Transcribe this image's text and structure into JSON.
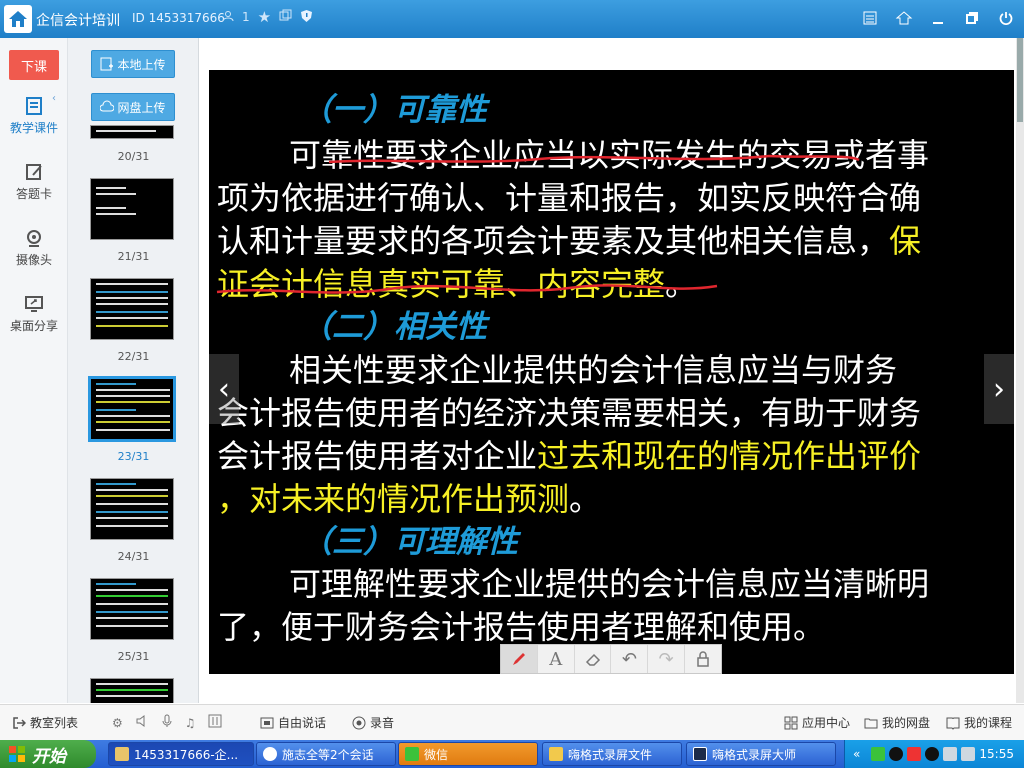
{
  "titlebar": {
    "app_name": "企信会计培训",
    "room_id": "ID 1453317666",
    "user_count": "1"
  },
  "sidebar": {
    "end_class": "下课",
    "items": [
      {
        "label": "教学课件"
      },
      {
        "label": "答题卡"
      },
      {
        "label": "摄像头"
      },
      {
        "label": "桌面分享"
      }
    ]
  },
  "panel": {
    "local_upload": "本地上传",
    "cloud_upload": "网盘上传",
    "pages": [
      "20/31",
      "21/31",
      "22/31",
      "23/31",
      "24/31",
      "25/31"
    ],
    "selected_page": "23/31"
  },
  "slide": {
    "h1": "（一）可靠性",
    "p1_lines": [
      "可靠性要求企业应当以实际发生的交易或者事",
      "项为依据进行确认、计量和报告，如实反映符合确",
      "认和计量要求的各项会计要素及其他相关信息，"
    ],
    "p1_highlight_a": "保",
    "p1_highlight_b": "证会计信息真实可靠、内容完整",
    "p1_end": "。",
    "h2": "（二）相关性",
    "p2_lines": [
      "相关性要求企业提供的会计信息应当与财务",
      "会计报告使用者的经济决策需要相关，有助于财务",
      "会计报告使用者对企业"
    ],
    "p2_highlight_a": "过去和现在的情况作出评价",
    "p2_highlight_b": "，对未来的情况作出预测",
    "p2_end": "。",
    "h3": "（三）可理解性",
    "p3_lines": [
      "可理解性要求企业提供的会计信息应当清晰明",
      "了，便于财务会计报告使用者理解和使用。"
    ],
    "colors": {
      "heading": "#1e9bd8",
      "highlight": "#f7f025",
      "annotation": "#e0262e"
    }
  },
  "bottombar": {
    "classroom_list": "教室列表",
    "free_talk": "自由说话",
    "record": "录音",
    "app_center": "应用中心",
    "my_drive": "我的网盘",
    "my_course": "我的课程"
  },
  "taskbar": {
    "start": "开始",
    "tasks": [
      "1453317666-企...",
      "施志全等2个会话",
      "微信",
      "嗨格式录屏文件",
      "嗨格式录屏大师"
    ],
    "clock": "15:55"
  }
}
